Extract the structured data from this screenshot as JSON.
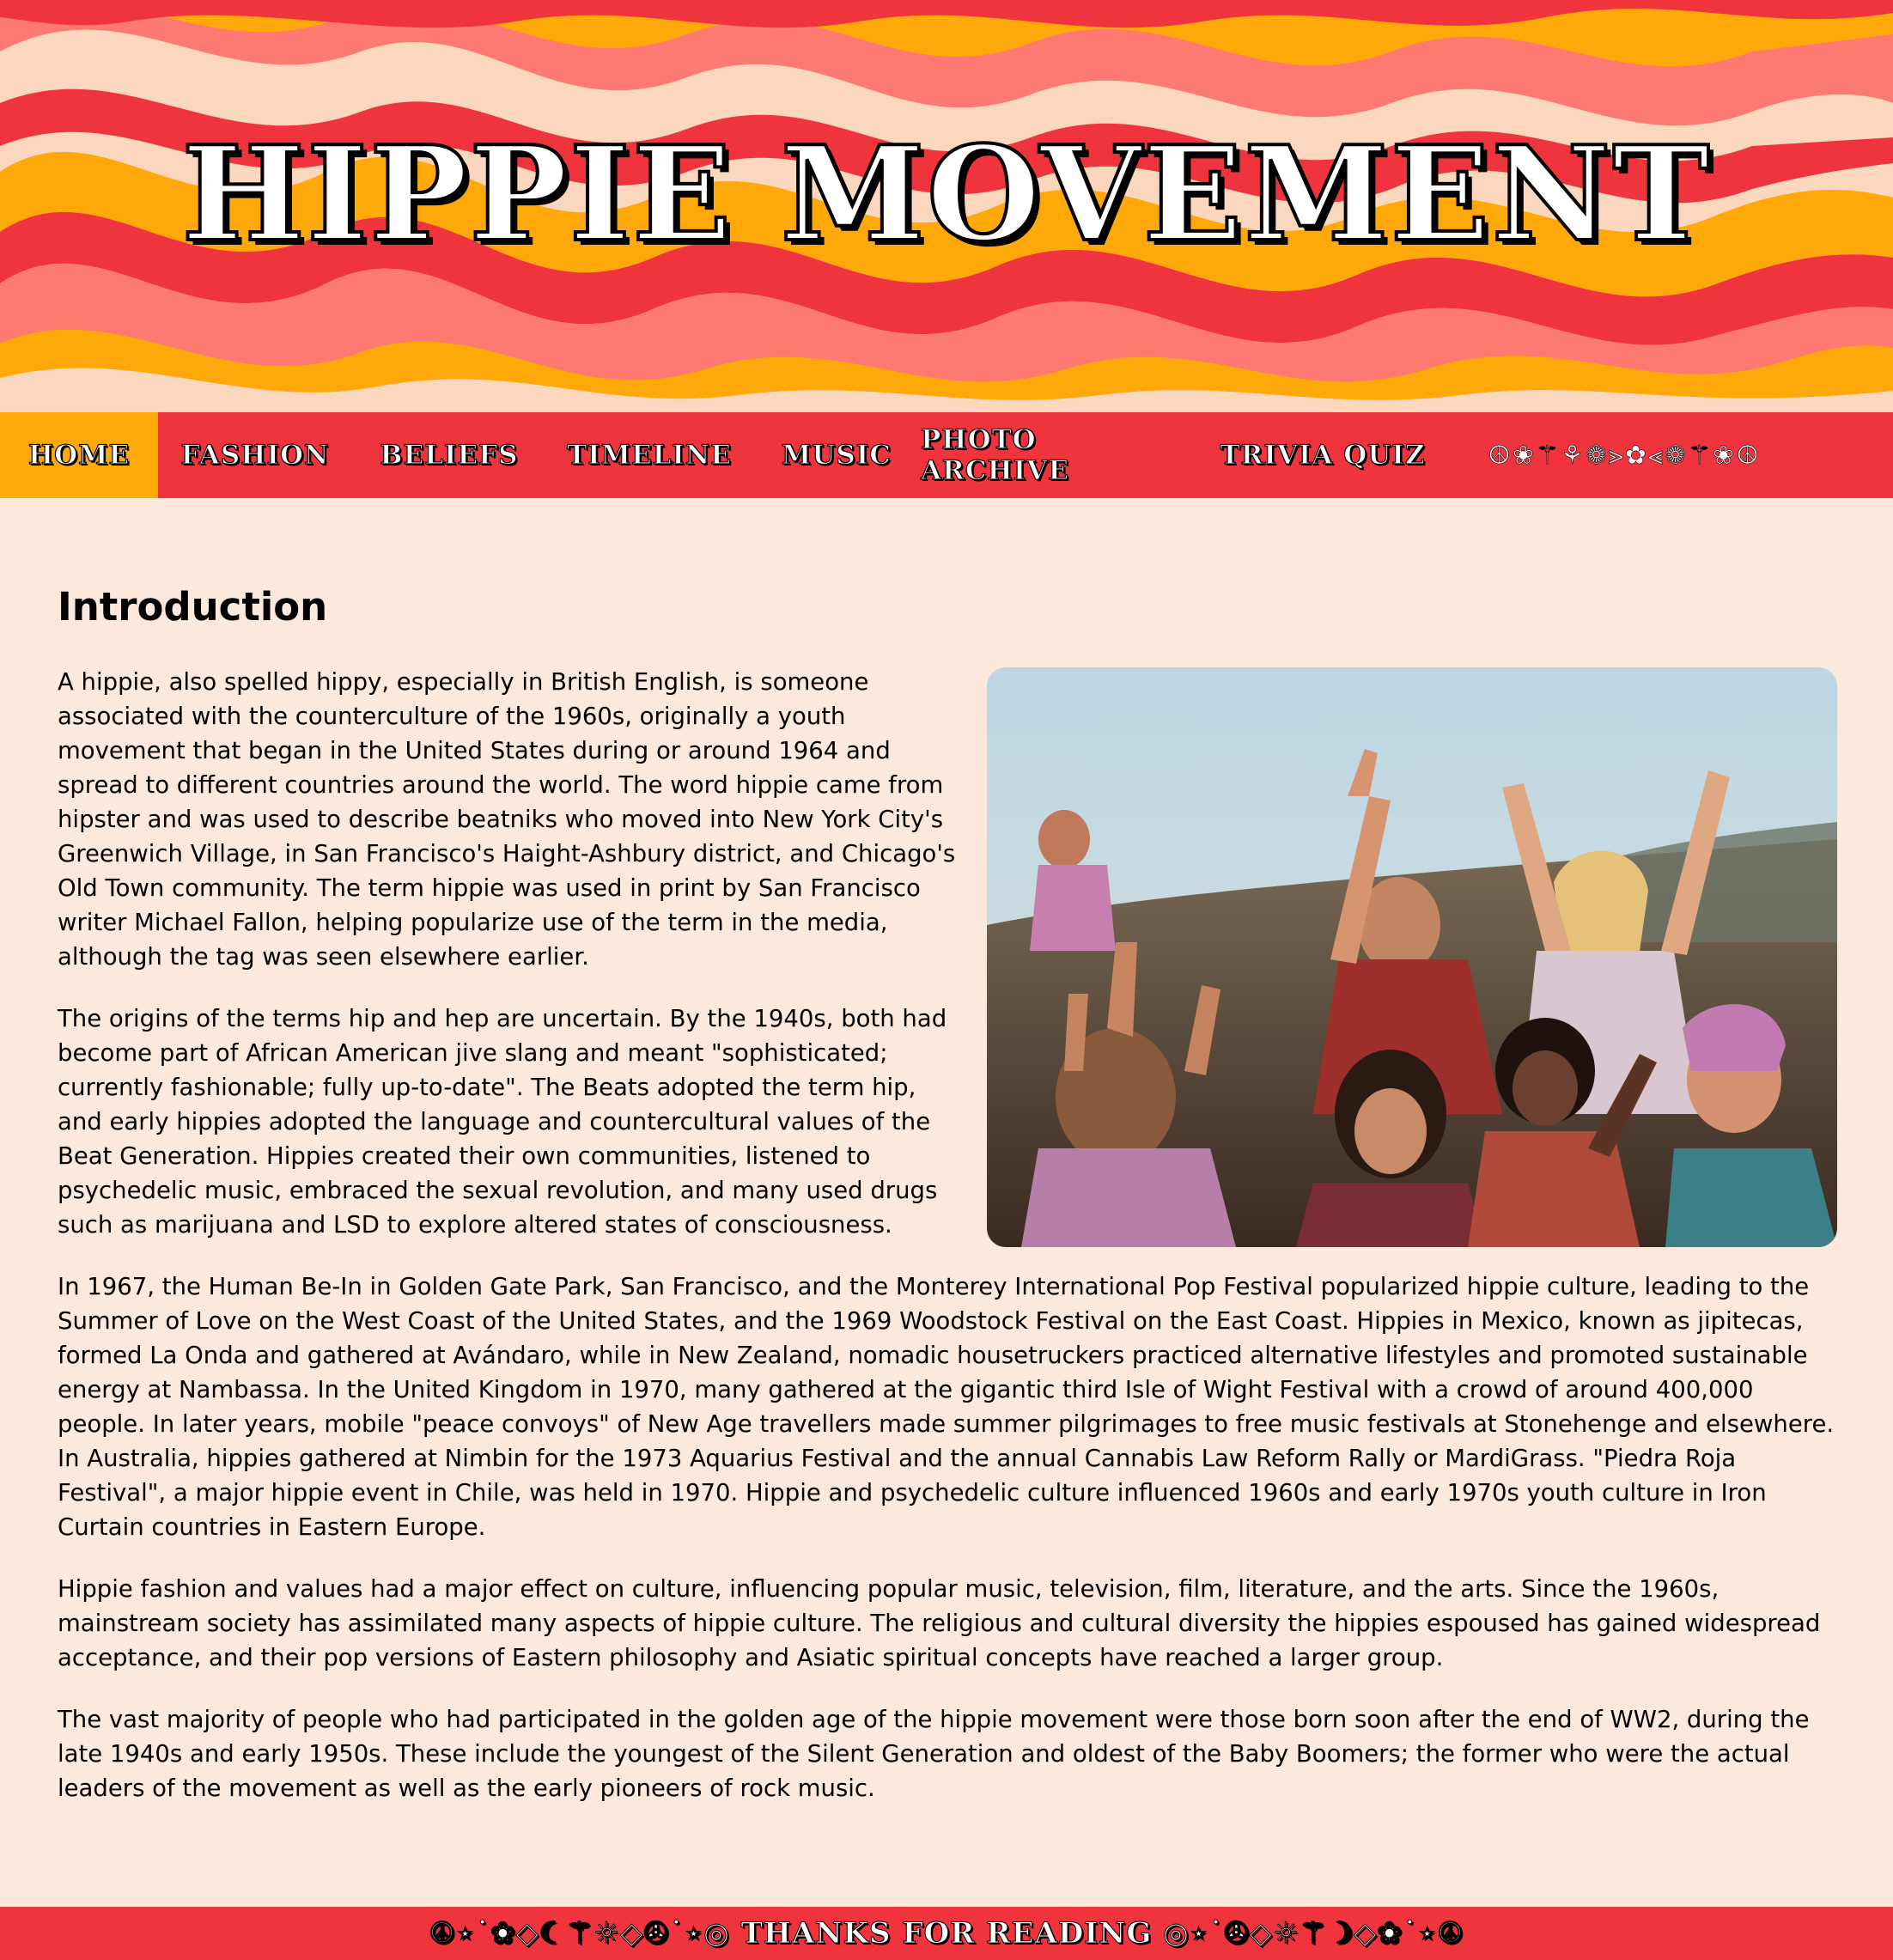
{
  "header": {
    "title": "HIPPIE MOVEMENT",
    "colors": {
      "peach": "#fbd7bd",
      "orange": "#ffa809",
      "coral": "#fc7a72",
      "red": "#f0343e"
    }
  },
  "nav": {
    "items": [
      {
        "label": "HOME",
        "active": true
      },
      {
        "label": "FASHION",
        "active": false
      },
      {
        "label": "BELIEFS",
        "active": false
      },
      {
        "label": "TIMELINE",
        "active": false
      },
      {
        "label": "MUSIC",
        "active": false
      },
      {
        "label": "PHOTO ARCHIVE",
        "active": false
      },
      {
        "label": "TRIVIA QUIZ",
        "active": false
      }
    ],
    "decoration": "☮❀⚚⚘❁⪢✿⪡❁⚚❀☮"
  },
  "main": {
    "heading": "Introduction",
    "photo_description_icon": "hippie-festival-photo",
    "paragraphs": [
      "A hippie, also spelled hippy, especially in British English, is someone associated with the counterculture of the 1960s, originally a youth movement that began in the United States during or around 1964 and spread to different countries around the world. The word hippie came from hipster and was used to describe beatniks who moved into New York City's Greenwich Village, in San Francisco's Haight-Ashbury district, and Chicago's Old Town community. The term hippie was used in print by San Francisco writer Michael Fallon, helping popularize use of the term in the media, although the tag was seen elsewhere earlier.",
      "The origins of the terms hip and hep are uncertain. By the 1940s, both had become part of African American jive slang and meant \"sophisticated; currently fashionable; fully up-to-date\". The Beats adopted the term hip, and early hippies adopted the language and countercultural values of the Beat Generation. Hippies created their own communities, listened to psychedelic music, embraced the sexual revolution, and many used drugs such as marijuana and LSD to explore altered states of consciousness.",
      "In 1967, the Human Be-In in Golden Gate Park, San Francisco, and the Monterey International Pop Festival popularized hippie culture, leading to the Summer of Love on the West Coast of the United States, and the 1969 Woodstock Festival on the East Coast. Hippies in Mexico, known as jipitecas, formed La Onda and gathered at Avándaro, while in New Zealand, nomadic housetruckers practiced alternative lifestyles and promoted sustainable energy at Nambassa. In the United Kingdom in 1970, many gathered at the gigantic third Isle of Wight Festival with a crowd of around 400,000 people. In later years, mobile \"peace convoys\" of New Age travellers made summer pilgrimages to free music festivals at Stonehenge and elsewhere. In Australia, hippies gathered at Nimbin for the 1973 Aquarius Festival and the annual Cannabis Law Reform Rally or MardiGrass. \"Piedra Roja Festival\", a major hippie event in Chile, was held in 1970. Hippie and psychedelic culture influenced 1960s and early 1970s youth culture in Iron Curtain countries in Eastern Europe.",
      "Hippie fashion and values had a major effect on culture, influencing popular music, television, film, literature, and the arts. Since the 1960s, mainstream society has assimilated many aspects of hippie culture. The religious and cultural diversity the hippies espoused has gained widespread acceptance, and their pop versions of Eastern philosophy and Asiatic spiritual concepts have reached a larger group.",
      "The vast majority of people who had participated in the golden age of the hippie movement were those born soon after the end of WW2, during the late 1940s and early 1950s. These include the youngest of the Silent Generation and oldest of the Baby Boomers; the former who were the actual leaders of the movement as well as the early pioneers of rock music."
    ]
  },
  "footer": {
    "text": "☮⋆˙❀◇☾⚚☼◇✇˙⋆◎ THANKS FOR READING ◎⋆˙✇◇☼⚚☽◇❀˙⋆☮"
  }
}
